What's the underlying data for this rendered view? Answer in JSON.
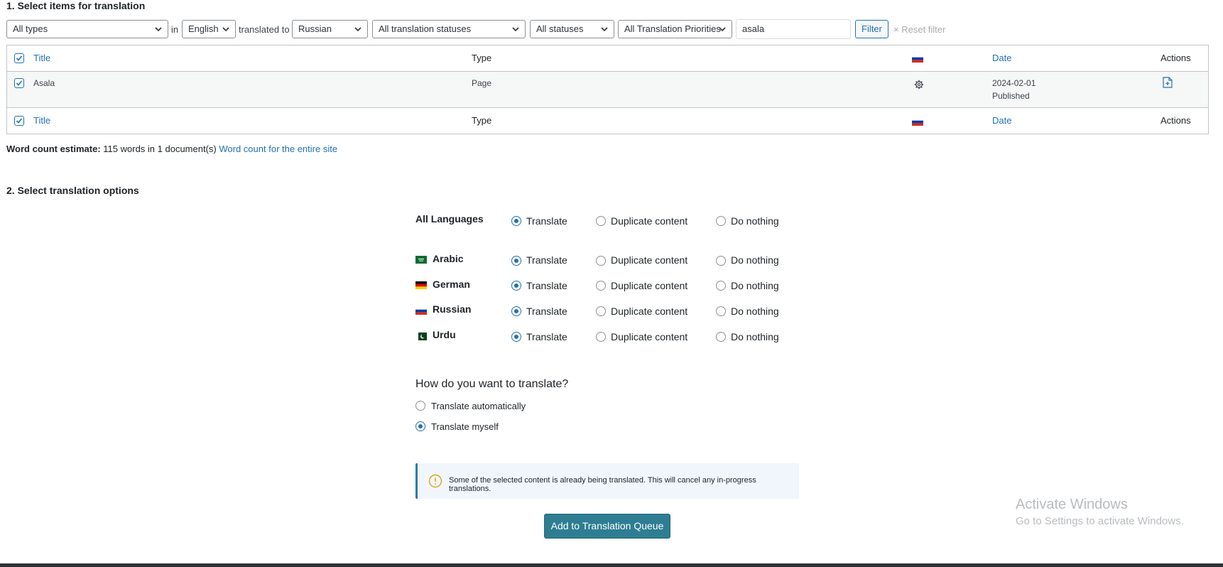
{
  "section1": {
    "title": "1. Select items for translation"
  },
  "filters": {
    "type": "All types",
    "in_label": "in",
    "from_lang": "English",
    "translated_to_label": "translated to",
    "to_lang": "Russian",
    "translation_status": "All translation statuses",
    "status": "All statuses",
    "priority": "All Translation Priorities",
    "search_value": "asala",
    "filter_button": "Filter",
    "reset_label": "Reset filter"
  },
  "table": {
    "headers": {
      "title": "Title",
      "type": "Type",
      "date": "Date",
      "actions": "Actions"
    },
    "rows": [
      {
        "title": "Asala",
        "type": "Page",
        "date": "2024-02-01",
        "status": "Published"
      }
    ]
  },
  "word_count": {
    "label": "Word count estimate:",
    "value": "115 words in 1 document(s)",
    "link": "Word count for the entire site"
  },
  "section2": {
    "title": "2. Select translation options"
  },
  "options": {
    "choices": {
      "translate": "Translate",
      "duplicate": "Duplicate content",
      "nothing": "Do nothing"
    },
    "all_languages": "All Languages",
    "languages": [
      {
        "name": "Arabic",
        "selected": "translate"
      },
      {
        "name": "German",
        "selected": "translate"
      },
      {
        "name": "Russian",
        "selected": "translate"
      },
      {
        "name": "Urdu",
        "selected": "translate"
      }
    ]
  },
  "how": {
    "title": "How do you want to translate?",
    "auto": "Translate automatically",
    "myself": "Translate myself",
    "selected": "myself"
  },
  "notice": {
    "text": "Some of the selected content is already being translated. This will cancel any in-progress translations."
  },
  "queue_button": "Add to Translation Queue",
  "watermark": {
    "line1": "Activate Windows",
    "line2": "Go to Settings to activate Windows."
  },
  "colors": {
    "accent": "#2271b1",
    "button": "#2e7d92",
    "warning": "#dba617"
  }
}
